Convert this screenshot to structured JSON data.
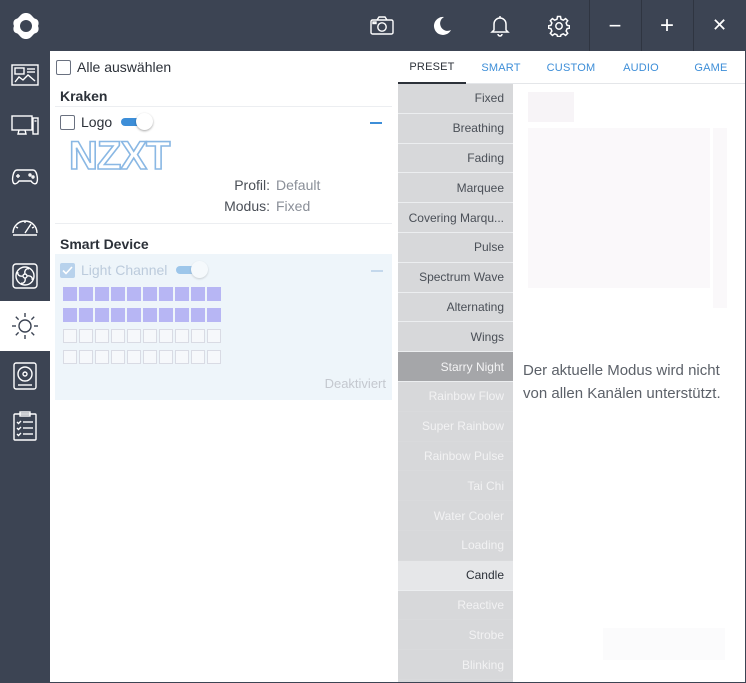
{
  "topbar": {
    "icons": [
      "camera-icon",
      "moon-icon",
      "bell-icon",
      "gear-icon"
    ],
    "window_controls": {
      "minimize": "−",
      "maximize": "+",
      "close": "✕"
    }
  },
  "sidebar": {
    "items": [
      "dashboard-icon",
      "monitor-icon",
      "gamepad-icon",
      "gauge-icon",
      "fan-icon",
      "lighting-icon",
      "drive-icon",
      "clipboard-icon"
    ],
    "active": "lighting-icon"
  },
  "devices": {
    "select_all_label": "Alle auswählen",
    "kraken": {
      "title": "Kraken",
      "channel_label": "Logo",
      "logo_text": "NZXT",
      "profile_label": "Profil:",
      "profile_value": "Default",
      "mode_label": "Modus:",
      "mode_value": "Fixed"
    },
    "smart_device": {
      "title": "Smart Device",
      "channel_label": "Light Channel",
      "status": "Deaktiviert",
      "leds_on": 20,
      "leds_total": 40
    }
  },
  "tabs": [
    "PRESET",
    "SMART",
    "CUSTOM",
    "AUDIO",
    "GAME"
  ],
  "active_tab": "PRESET",
  "effects": [
    {
      "label": "Fixed",
      "state": "normal"
    },
    {
      "label": "Breathing",
      "state": "normal"
    },
    {
      "label": "Fading",
      "state": "normal"
    },
    {
      "label": "Marquee",
      "state": "normal"
    },
    {
      "label": "Covering Marqu...",
      "state": "normal"
    },
    {
      "label": "Pulse",
      "state": "normal"
    },
    {
      "label": "Spectrum Wave",
      "state": "normal"
    },
    {
      "label": "Alternating",
      "state": "normal"
    },
    {
      "label": "Wings",
      "state": "normal"
    },
    {
      "label": "Starry Night",
      "state": "selected"
    },
    {
      "label": "Rainbow Flow",
      "state": "disabled"
    },
    {
      "label": "Super Rainbow",
      "state": "disabled"
    },
    {
      "label": "Rainbow Pulse",
      "state": "disabled"
    },
    {
      "label": "Tai Chi",
      "state": "disabled"
    },
    {
      "label": "Water Cooler",
      "state": "disabled"
    },
    {
      "label": "Loading",
      "state": "disabled"
    },
    {
      "label": "Candle",
      "state": "active"
    },
    {
      "label": "Reactive",
      "state": "disabled"
    },
    {
      "label": "Strobe",
      "state": "disabled"
    },
    {
      "label": "Blinking",
      "state": "disabled"
    }
  ],
  "notice": "Der aktuelle Modus wird nicht von allen Kanälen unterstützt.",
  "colors": {
    "chrome": "#3c4453",
    "accent": "#3d8ed8",
    "led_on": "#b7b6f4",
    "disabled_bg": "#eef5fa"
  }
}
